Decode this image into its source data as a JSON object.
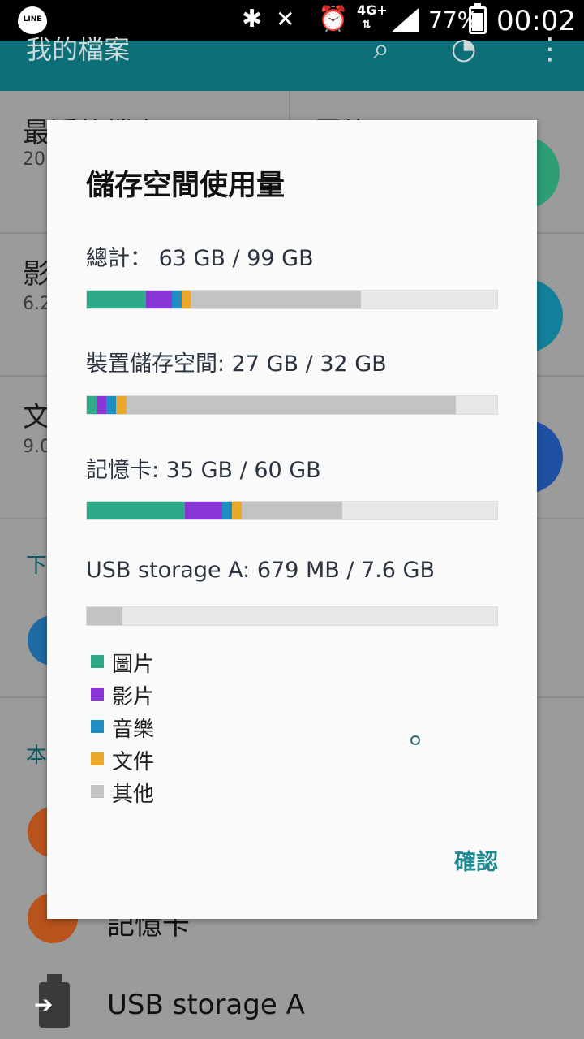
{
  "statusbar": {
    "line_label": "LINE",
    "network": "4G+",
    "network_arrows": "⇅",
    "battery": "77%",
    "battery_level": 0.77,
    "time": "00:02",
    "icons": [
      "bluetooth-icon",
      "mute-icon",
      "alarm-icon",
      "signal-icon",
      "battery-icon"
    ]
  },
  "appbar": {
    "title": "我的檔案",
    "icons": [
      "search-icon",
      "storage-usage-icon",
      "more-icon"
    ]
  },
  "background": {
    "tiles": [
      {
        "title": "最近的檔案",
        "sub": "20"
      },
      {
        "title": "圖片",
        "sub": ""
      },
      {
        "title": "影",
        "sub": "6.2"
      },
      {
        "title": "文",
        "sub": "9.0"
      }
    ],
    "sections": [
      "下",
      "本"
    ],
    "rows": [
      "記憶卡",
      "USB storage A"
    ]
  },
  "dialog": {
    "title": "儲存空間使用量",
    "total_label": "總計： 63 GB / 99 GB",
    "device_label": "裝置儲存空間: 27 GB / 32 GB",
    "sdcard_label": "記憶卡: 35 GB / 60 GB",
    "usb_label": "USB storage A: 679 MB / 7.6 GB",
    "ok_label": "確認"
  },
  "usage": {
    "colors": {
      "images": "#2eaa88",
      "videos": "#8a36d6",
      "music": "#1f8fc3",
      "documents": "#eba92c",
      "other": "#c3c3c3",
      "empty": "#e7e7e7"
    },
    "total": {
      "images": 0.145,
      "videos": 0.062,
      "music": 0.024,
      "documents": 0.022,
      "other": 0.415
    },
    "device": {
      "images": 0.024,
      "videos": 0.024,
      "music": 0.024,
      "documents": 0.024,
      "other": 0.803
    },
    "sdcard": {
      "images": 0.24,
      "videos": 0.09,
      "music": 0.024,
      "documents": 0.024,
      "other": 0.245
    },
    "usb": {
      "images": 0.0,
      "videos": 0.0,
      "music": 0.0,
      "documents": 0.0,
      "other": 0.087
    }
  },
  "legend": [
    {
      "key": "images",
      "label": "圖片"
    },
    {
      "key": "videos",
      "label": "影片"
    },
    {
      "key": "music",
      "label": "音樂"
    },
    {
      "key": "documents",
      "label": "文件"
    },
    {
      "key": "other",
      "label": "其他"
    }
  ]
}
